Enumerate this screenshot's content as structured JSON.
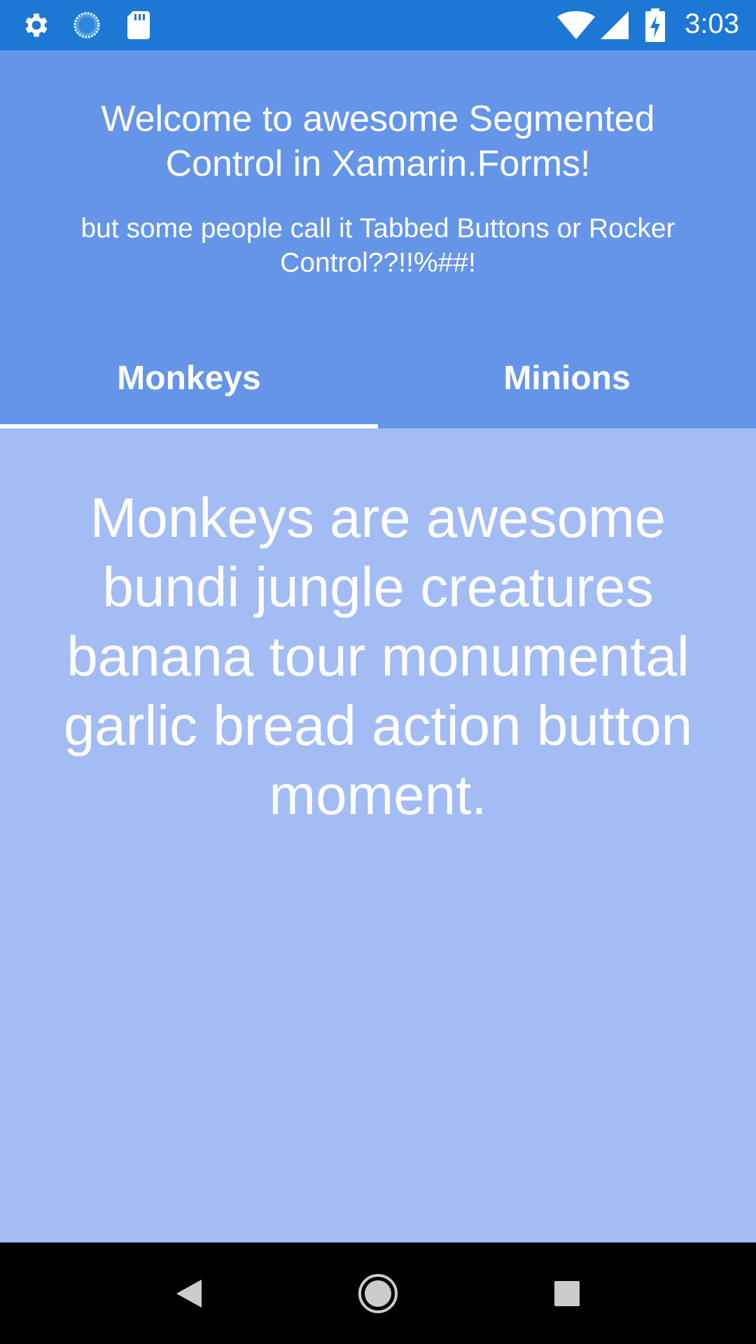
{
  "status_bar": {
    "time": "3:03",
    "icons": [
      "gear-icon",
      "sync-icon",
      "sd-card-icon",
      "wifi-icon",
      "signal-icon",
      "battery-charging-icon"
    ]
  },
  "header": {
    "title": "Welcome to awesome Segmented Control in Xamarin.Forms!",
    "subtitle": "but some people call it Tabbed Buttons or Rocker Control??!!%##!"
  },
  "tabs": [
    {
      "label": "Monkeys",
      "selected": true
    },
    {
      "label": "Minions",
      "selected": false
    }
  ],
  "content": {
    "text": "Monkeys are awesome bundi jungle creatures banana tour monumental garlic bread action button moment."
  },
  "nav_bar": {
    "icons": [
      "back-icon",
      "home-icon",
      "recents-icon"
    ]
  },
  "colors": {
    "status_bar": "#1c78d4",
    "header": "#6595e9",
    "content": "#a3bcf4",
    "nav_bar": "#000000"
  }
}
